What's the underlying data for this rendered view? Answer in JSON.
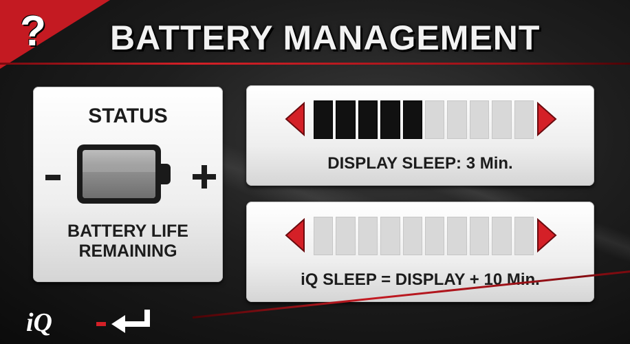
{
  "header": {
    "title": "BATTERY MANAGEMENT",
    "help_icon": "question-mark-icon",
    "accent_color": "#c41a22"
  },
  "status": {
    "title": "STATUS",
    "caption_line1": "BATTERY LIFE",
    "caption_line2": "REMAINING",
    "battery_level": 0.55
  },
  "display_sleep": {
    "label": "DISPLAY SLEEP: 3 Min.",
    "filled_segments": 5,
    "total_segments": 10
  },
  "iq_sleep": {
    "label": "iQ SLEEP = DISPLAY + 10 Min.",
    "filled_segments": 0,
    "total_segments": 10
  },
  "footer": {
    "logo": "iQ",
    "back_icon": "return-arrow-icon"
  }
}
